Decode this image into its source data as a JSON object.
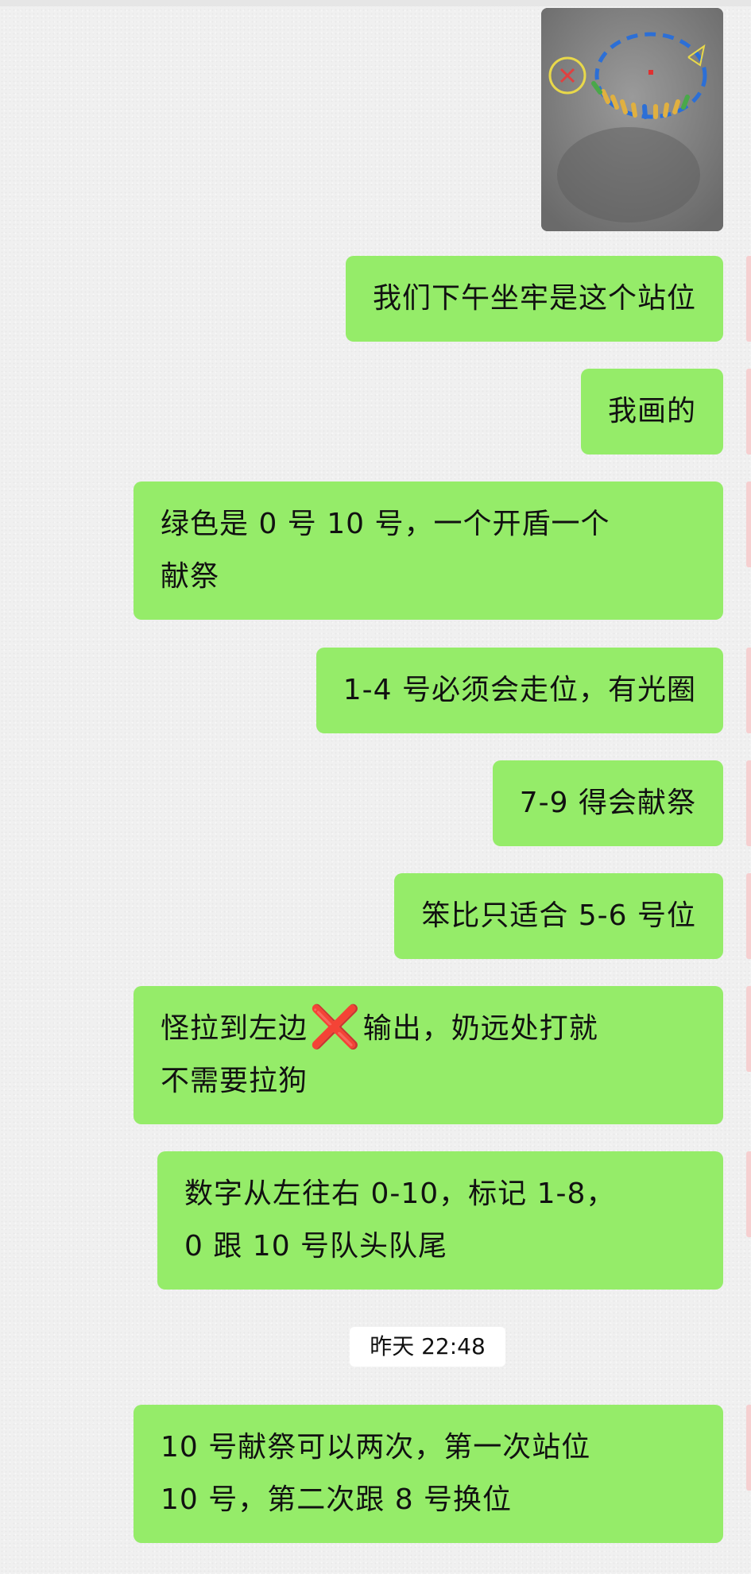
{
  "colors": {
    "bubble_green": "#95ec69",
    "background": "#f0f0f0",
    "timestamp_bg": "#ffffff",
    "cross_red": "#e02020"
  },
  "image_message": {
    "icon": "drawn-formation-diagram"
  },
  "messages": [
    {
      "text": "我们下午坐牢是这个站位"
    },
    {
      "text": "我画的"
    },
    {
      "line1": "绿色是 0 号 10 号，一个开盾一个",
      "line2": "献祭"
    },
    {
      "text": "1-4 号必须会走位，有光圈"
    },
    {
      "text": "7-9 得会献祭"
    },
    {
      "text": "笨比只适合 5-6 号位"
    },
    {
      "line1_a": "怪拉到左边",
      "cross": "❌",
      "line1_b": "输出，奶远处打就",
      "line2": "不需要拉狗"
    },
    {
      "line1": "数字从左往右 0-10，标记 1-8，",
      "line2": "0 跟 10 号队头队尾"
    },
    {
      "line1": "10 号献祭可以两次，第一次站位",
      "line2": "10 号，第二次跟 8 号换位"
    }
  ],
  "timestamp": "昨天 22:48"
}
